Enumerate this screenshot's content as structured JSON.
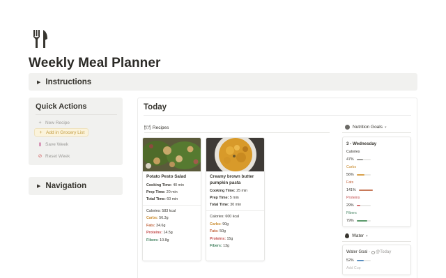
{
  "page": {
    "icon": "fork-knife-icon",
    "title": "Weekly Meal Planner"
  },
  "instructions": {
    "label": "Instructions"
  },
  "quick_actions": {
    "title": "Quick Actions",
    "buttons": [
      {
        "label": "New Recipe",
        "icon": "plus-icon"
      },
      {
        "label": "Add in Grocery List",
        "icon": "plus-icon"
      },
      {
        "label": "Save Week",
        "icon": "save-icon"
      },
      {
        "label": "Reset Week",
        "icon": "reset-icon"
      }
    ]
  },
  "navigation": {
    "label": "Navigation"
  },
  "today": {
    "title": "Today",
    "recipes_label": "Recipes",
    "recipes": [
      {
        "name": "Potato Pesto Salad",
        "cooking_time_label": "Cooking Time:",
        "cooking_time": "40 min",
        "prep_time_label": "Prep Time:",
        "prep_time": "20 min",
        "total_time_label": "Total Time:",
        "total_time": "60 min",
        "calories_label": "Calories:",
        "calories": "583 kcal",
        "carbs_label": "Carbs:",
        "carbs": "56.3g",
        "fats_label": "Fats:",
        "fats": "34.6g",
        "proteins_label": "Proteins:",
        "proteins": "14.5g",
        "fibers_label": "Fibers:",
        "fibers": "10.8g"
      },
      {
        "name": "Creamy brown butter pumpkin pasta",
        "cooking_time_label": "Cooking Time:",
        "cooking_time": "25 min",
        "prep_time_label": "Prep Time:",
        "prep_time": "5 min",
        "total_time_label": "Total Time:",
        "total_time": "30 min",
        "calories_label": "Calories:",
        "calories": "600 kcal",
        "carbs_label": "Carbs:",
        "carbs": "90g",
        "fats_label": "Fats:",
        "fats": "50g",
        "proteins_label": "Proteins:",
        "proteins": "15g",
        "fibers_label": "Fibers:",
        "fibers": "13g"
      }
    ]
  },
  "nutrition_goals": {
    "label": "Nutrition Goals",
    "day": "3 - Wednesday",
    "items": [
      {
        "label": "Calories",
        "value": "47%",
        "percent": 47,
        "color": "#9b9a97",
        "label_color": "#37352f"
      },
      {
        "label": "Carbs",
        "value": "56%",
        "percent": 56,
        "color": "#d9a14a",
        "label_color": "#c98a2b"
      },
      {
        "label": "Fats",
        "value": "141%",
        "percent": 100,
        "color": "#c87a5a",
        "label_color": "#c0623a"
      },
      {
        "label": "Proteins",
        "value": "29%",
        "percent": 29,
        "color": "#d26d6d",
        "label_color": "#c24d4d"
      },
      {
        "label": "Fibers",
        "value": "79%",
        "percent": 79,
        "color": "#5b9a6b",
        "label_color": "#448361"
      }
    ]
  },
  "water": {
    "label": "Water",
    "goal_label": "Water Goal",
    "goal_date": "@Today",
    "value": "52%",
    "percent": 52,
    "add_cup": "Add Cup"
  },
  "colors": {
    "carbs": "#c98a2b",
    "fats": "#c0623a",
    "proteins": "#c24d4d",
    "fibers": "#448361"
  }
}
